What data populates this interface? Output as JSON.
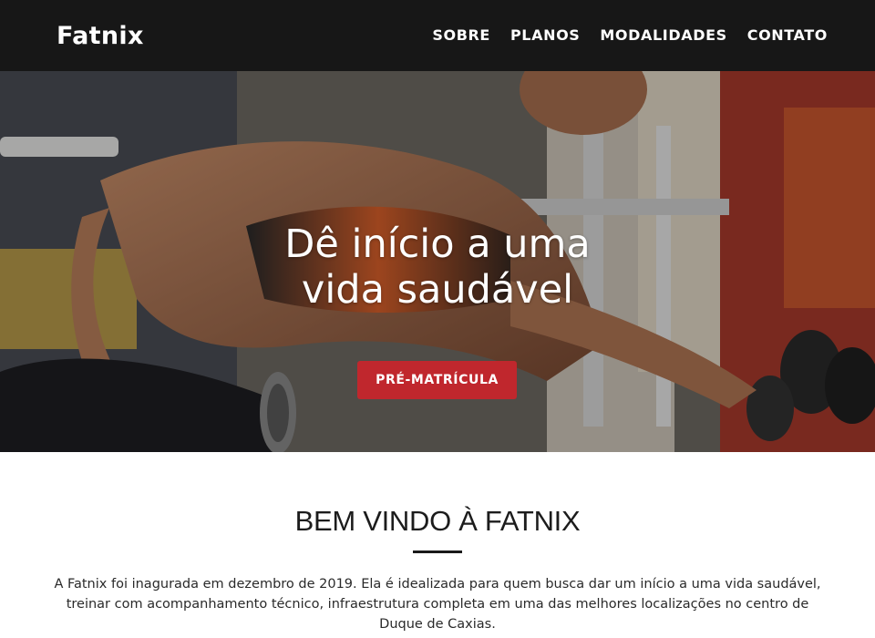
{
  "brand": "Fatnix",
  "nav": {
    "items": [
      "SOBRE",
      "PLANOS",
      "MODALIDADES",
      "CONTATO"
    ]
  },
  "hero": {
    "title_line1": "Dê início a uma",
    "title_line2": "vida saudável",
    "cta_label": "PRÉ-MATRÍCULA",
    "cta_color": "#c0272d"
  },
  "welcome": {
    "heading": "BEM VINDO À FATNIX",
    "text": "A Fatnix foi inagurada em dezembro de 2019. Ela é idealizada para quem busca dar um início a uma vida saudável, treinar com acompanhamento técnico, infraestrutura completa em uma das melhores localizações no centro de Duque de Caxias."
  },
  "colors": {
    "navbar": "#171717",
    "accent": "#c0272d"
  }
}
